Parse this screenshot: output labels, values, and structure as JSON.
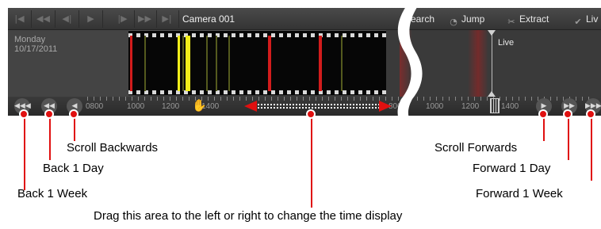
{
  "toolbar": {
    "playback_icons": [
      "skip-to-start-icon",
      "step-back-icon",
      "play-reverse-icon",
      "play-icon",
      "pause-step-icon",
      "fast-forward-icon",
      "skip-to-end-icon"
    ],
    "camera_name": "Camera 001",
    "search_label": "earch",
    "jump_label": "Jump",
    "extract_label": "Extract",
    "live_label": "Liv"
  },
  "timeline": {
    "day": "Monday",
    "date": "10/17/2011",
    "live_marker": "Live",
    "ticks_left": [
      "0800",
      "1000",
      "1200",
      "1400",
      "",
      "800"
    ],
    "ticks_right": [
      "1000",
      "1200",
      "1400"
    ],
    "colors": {
      "motion": "#d21c1c",
      "alarm": "#f2ee1a",
      "minor": "#545a1e"
    }
  },
  "callouts": {
    "scroll_backwards": "Scroll Backwards",
    "back_1_day": "Back 1 Day",
    "back_1_week": "Back 1 Week",
    "scroll_forwards": "Scroll Forwards",
    "forward_1_day": "Forward 1 Day",
    "forward_1_week": "Forward 1 Week",
    "drag_area": "Drag this area to the left or right to change the time display"
  }
}
